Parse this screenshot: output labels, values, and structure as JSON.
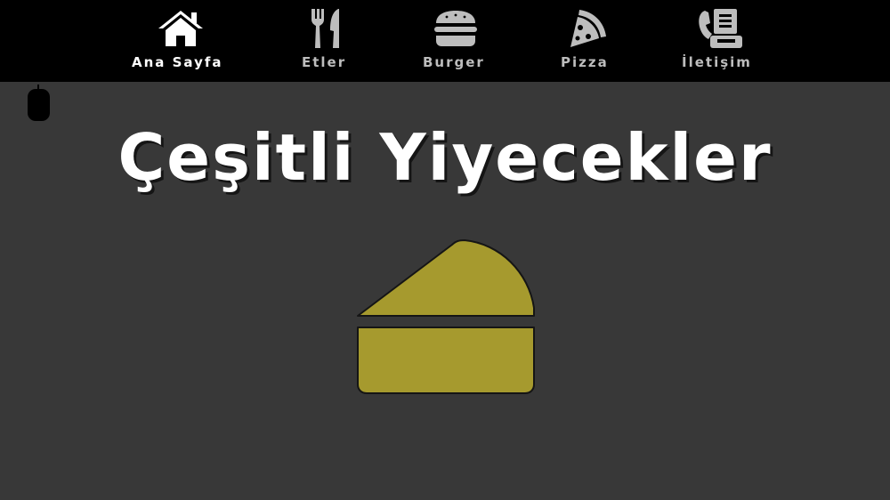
{
  "nav": {
    "items": [
      {
        "label": "Ana Sayfa",
        "icon": "home-icon",
        "active": true
      },
      {
        "label": "Etler",
        "icon": "fork-knife-icon",
        "active": false
      },
      {
        "label": "Burger",
        "icon": "burger-icon",
        "active": false
      },
      {
        "label": "Pizza",
        "icon": "pizza-slice-icon",
        "active": false
      },
      {
        "label": "İletişim",
        "icon": "phone-fax-icon",
        "active": false
      }
    ]
  },
  "main": {
    "title": "Çeşitli Yiyecekler",
    "hero_icon": "cheese-icon"
  },
  "colors": {
    "background": "#383838",
    "navbar": "#000000",
    "active_nav": "#ffffff",
    "inactive_nav": "#bdbdbd",
    "cheese": "#a69a2e"
  }
}
